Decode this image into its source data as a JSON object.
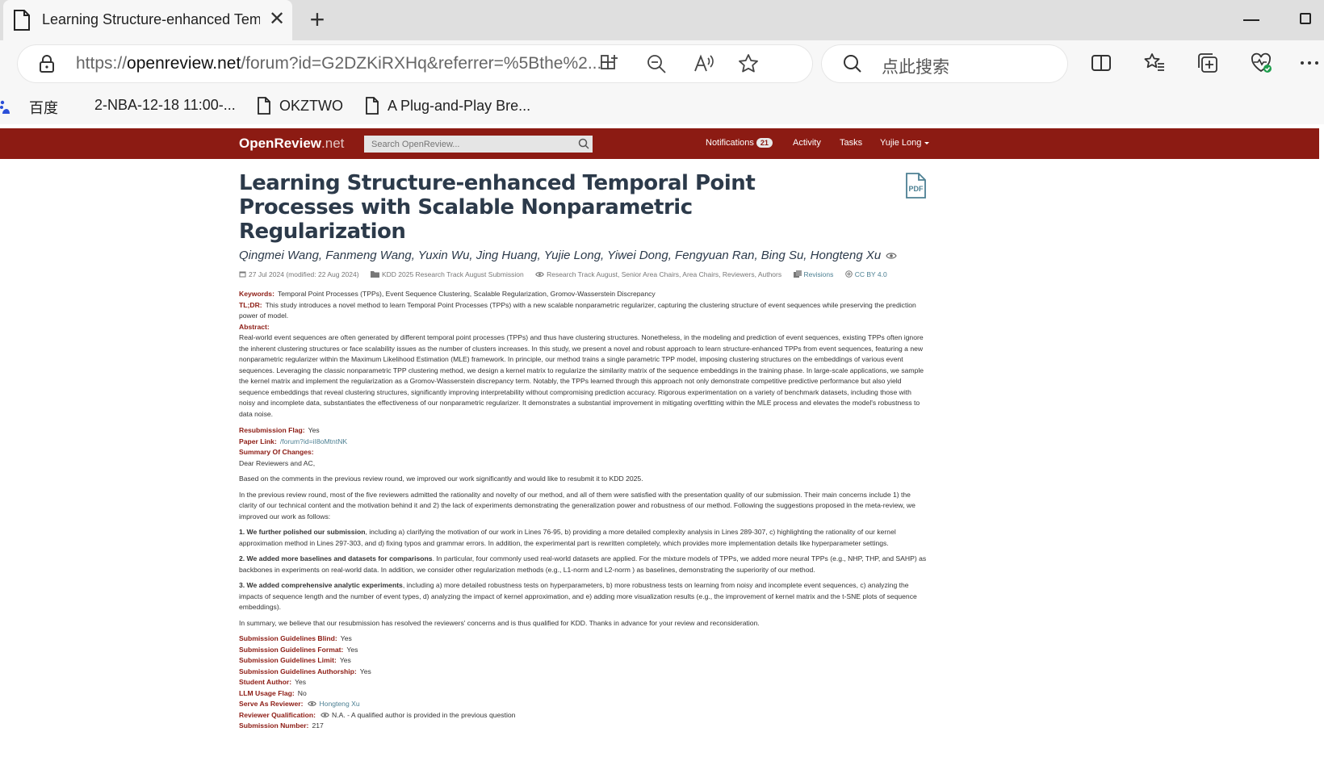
{
  "browser": {
    "tab_title": "Learning Structure-enhanced Tem",
    "url_prefix": "https://",
    "url_host": "openreview.net",
    "url_rest": "/forum?id=G2DZKiRXHq&referrer=%5Bthe%2...",
    "search_placeholder": "点此搜索",
    "bookmarks": [
      "百度",
      "2-NBA-12-18 11:00-...",
      "OKZTWO",
      "A Plug-and-Play Bre..."
    ]
  },
  "navbar": {
    "logo_main": "OpenReview",
    "logo_suffix": ".net",
    "search_placeholder": "Search OpenReview...",
    "notifications_label": "Notifications",
    "notifications_count": "21",
    "activity_label": "Activity",
    "tasks_label": "Tasks",
    "user_label": "Yujie Long"
  },
  "paper": {
    "title": "Learning Structure-enhanced Temporal Point Processes with Scalable Nonparametric Regularization",
    "authors": "Qingmei Wang, Fanmeng Wang, Yuxin Wu, Jing Huang, Yujie Long, Yiwei Dong, Fengyuan Ran, Bing Su, Hongteng Xu",
    "date": "27 Jul 2024 (modified: 22 Aug 2024)",
    "venue": "KDD 2025 Research Track August Submission",
    "readers": "Research Track August, Senior Area Chairs, Area Chairs, Reviewers, Authors",
    "revisions": "Revisions",
    "license": "CC BY 4.0",
    "keywords_label": "Keywords:",
    "keywords": "Temporal Point Processes (TPPs), Event Sequence Clustering, Scalable Regularization, Gromov-Wasserstein Discrepancy",
    "tldr_label": "TL;DR:",
    "tldr": "This study introduces a novel method to learn Temporal Point Processes (TPPs) with a new scalable nonparametric regularizer, capturing the clustering structure of event sequences while preserving the prediction power of model.",
    "abstract_label": "Abstract:",
    "abstract": "Real-world event sequences are often generated by different temporal point processes (TPPs) and thus have clustering structures. Nonetheless, in the modeling and prediction of event sequences, existing TPPs often ignore the inherent clustering structures or face scalability issues as the number of clusters increases. In this study, we present a novel and robust approach to learn structure-enhanced TPPs from event sequences, featuring a new nonparametric regularizer within the Maximum Likelihood Estimation (MLE) framework. In principle, our method trains a single parametric TPP model, imposing clustering structures on the embeddings of various event sequences. Leveraging the classic nonparametric TPP clustering method, we design a kernel matrix to regularize the similarity matrix of the sequence embeddings in the training phase. In large-scale applications, we sample the kernel matrix and implement the regularization as a Gromov-Wasserstein discrepancy term. Notably, the TPPs learned through this approach not only demonstrate competitive predictive performance but also yield sequence embeddings that reveal clustering structures, significantly improving interpretability without compromising prediction accuracy. Rigorous experimentation on a variety of benchmark datasets, including those with noisy and incomplete data, substantiates the effectiveness of our nonparametric regularizer. It demonstrates a substantial improvement in mitigating overfitting within the MLE process and elevates the model's robustness to data noise.",
    "resubmission_label": "Resubmission Flag:",
    "resubmission": "Yes",
    "paper_link_label": "Paper Link:",
    "paper_link": "/forum?id=iI8oMtntNK",
    "summary_label": "Summary Of Changes:",
    "summary_p1": "Dear Reviewers and AC,",
    "summary_p2": "Based on the comments in the previous review round, we improved our work significantly and would like to resubmit it to KDD 2025.",
    "summary_p3": "In the previous review round, most of the five reviewers admitted the rationality and novelty of our method, and all of them were satisfied with the presentation quality of our submission. Their main concerns include 1) the clarity of our technical content and the motivation behind it and 2) the lack of experiments demonstrating the generalization power and robustness of our method. Following the suggestions proposed in the meta-review, we improved our work as follows:",
    "summary_p4_bold": "1. We further polished our submission",
    "summary_p4": ", including a) clarifying the motivation of our work in Lines 76-95, b) providing a more detailed complexity analysis in Lines 289-307, c) highlighting the rationality of our kernel approximation method in Lines 297-303, and d) fixing typos and grammar errors. In addition, the experimental part is rewritten completely, which provides more implementation details like hyperparameter settings.",
    "summary_p5_bold": "2. We added more baselines and datasets for comparisons",
    "summary_p5": ". In particular, four commonly used real-world datasets are applied. For the mixture models of TPPs, we added more neural TPPs (e.g., NHP, THP, and SAHP) as backbones in experiments on real-world data. In addition, we consider other regularization methods (e.g., L1-norm and L2-norm ) as baselines, demonstrating the superiority of our method.",
    "summary_p6_bold": "3. We added comprehensive analytic experiments",
    "summary_p6": ", including a) more detailed robustness tests on hyperparameters, b) more robustness tests on learning from noisy and incomplete event sequences, c) analyzing the impacts of sequence length and the number of event types, d) analyzing the impact of kernel approximation, and e) adding more visualization results (e.g., the improvement of kernel matrix and the t-SNE plots of sequence embeddings).",
    "summary_p7": "In summary, we believe that our resubmission has resolved the reviewers' concerns and is thus qualified for KDD. Thanks in advance for your review and reconsideration.",
    "blind_label": "Submission Guidelines Blind:",
    "blind": "Yes",
    "format_label": "Submission Guidelines Format:",
    "format": "Yes",
    "limit_label": "Submission Guidelines Limit:",
    "limit": "Yes",
    "authorship_label": "Submission Guidelines Authorship:",
    "authorship": "Yes",
    "student_label": "Student Author:",
    "student": "Yes",
    "llm_label": "LLM Usage Flag:",
    "llm": "No",
    "reviewer_label": "Serve As Reviewer:",
    "reviewer": "Hongteng Xu",
    "qualification_label": "Reviewer Qualification:",
    "qualification": "N.A. - A qualified author is provided in the previous question",
    "number_label": "Submission Number:",
    "number": "217"
  }
}
